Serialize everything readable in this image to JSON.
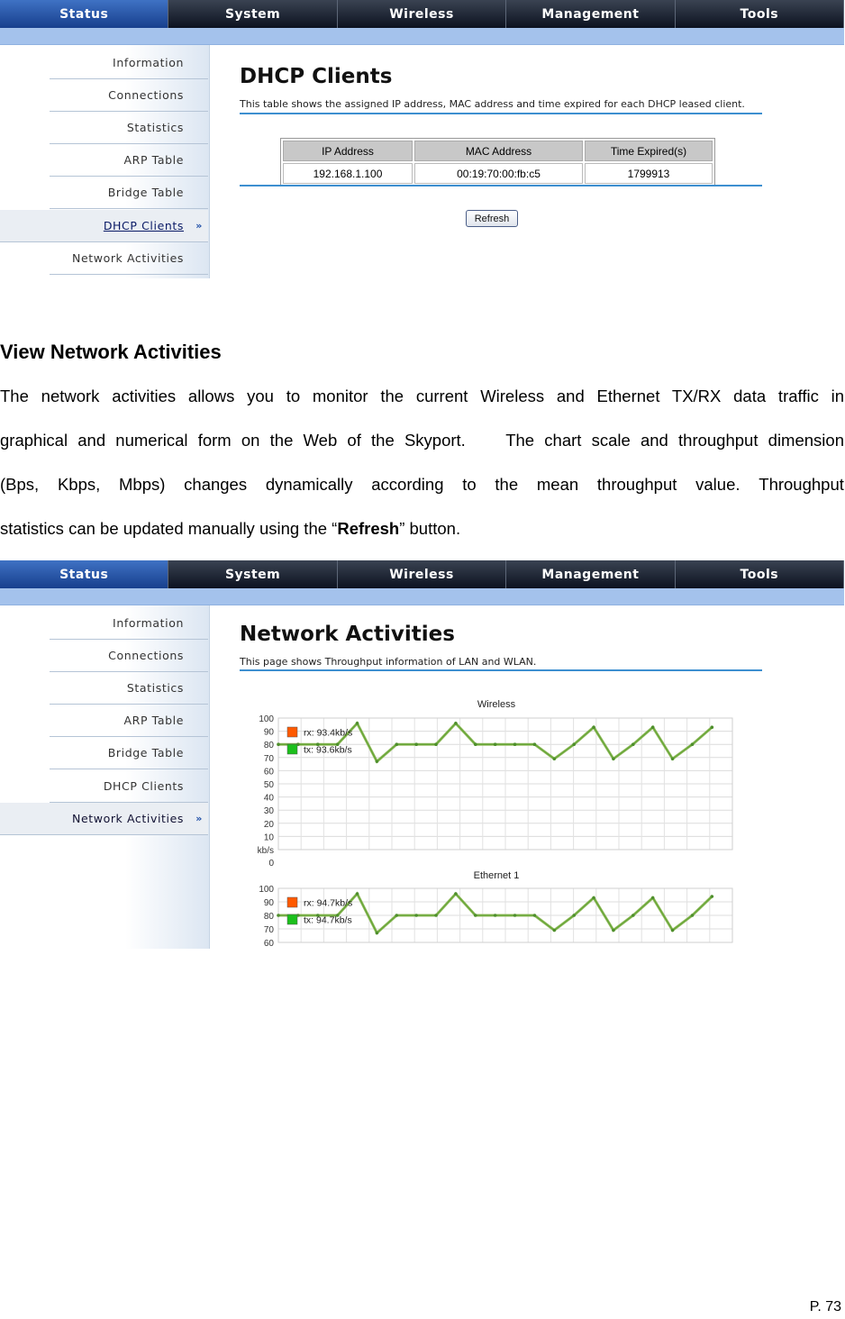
{
  "screenshot1": {
    "nav_tabs": [
      "Status",
      "System",
      "Wireless",
      "Management",
      "Tools"
    ],
    "sidebar": [
      "Information",
      "Connections",
      "Statistics",
      "ARP Table",
      "Bridge Table",
      "DHCP Clients",
      "Network Activities"
    ],
    "active_item": "DHCP Clients",
    "title": "DHCP Clients",
    "description": "This table shows the assigned IP address, MAC address and time expired for each DHCP leased client.",
    "table": {
      "headers": [
        "IP Address",
        "MAC Address",
        "Time Expired(s)"
      ],
      "rows": [
        [
          "192.168.1.100",
          "00:19:70:00:fb:c5",
          "1799913"
        ]
      ]
    },
    "refresh_label": "Refresh"
  },
  "section_heading": "View Network Activities",
  "paragraph": {
    "line1": "The network activities allows you to monitor the current Wireless and Ethernet TX/RX data traffic in",
    "line2": "graphical and numerical form on the Web of the Skyport.    The chart scale and throughput dimension",
    "line3_words": [
      "(Bps,",
      "Kbps,",
      "Mbps)",
      "changes",
      "dynamically",
      "according",
      "to",
      "the",
      "mean",
      "throughput",
      "value.",
      "Throughput"
    ],
    "line4_before": "statistics can be updated manually using the “",
    "line4_bold": "Refresh",
    "line4_after": "” button."
  },
  "screenshot2": {
    "nav_tabs": [
      "Status",
      "System",
      "Wireless",
      "Management",
      "Tools"
    ],
    "sidebar": [
      "Information",
      "Connections",
      "Statistics",
      "ARP Table",
      "Bridge Table",
      "DHCP Clients",
      "Network Activities"
    ],
    "active_item": "Network Activities",
    "title": "Network Activities",
    "description": "This page shows Throughput information of LAN and WLAN.",
    "arrow_glyph": "»"
  },
  "chart_data": [
    {
      "type": "line",
      "title": "Wireless",
      "ylabel": "kb/s",
      "ylim": [
        0,
        100
      ],
      "yticks": [
        100,
        90,
        80,
        70,
        60,
        50,
        40,
        30,
        20,
        10,
        0
      ],
      "grid": true,
      "legend_placement": "top-left",
      "series": [
        {
          "name": "rx: 93.4kb/s",
          "color": "#ff5a00",
          "values": [
            80,
            80,
            80,
            80,
            96,
            67,
            80,
            80,
            80,
            96,
            80,
            80,
            80,
            80,
            69,
            80,
            93,
            69,
            80,
            93,
            69,
            80,
            93
          ]
        },
        {
          "name": "tx: 93.6kb/s",
          "color": "#1cc01c",
          "values": [
            80,
            80,
            80,
            80,
            96,
            67,
            80,
            80,
            80,
            96,
            80,
            80,
            80,
            80,
            69,
            80,
            93,
            69,
            80,
            93,
            69,
            80,
            93
          ]
        }
      ]
    },
    {
      "type": "line",
      "title": "Ethernet 1",
      "ylim": [
        60,
        100
      ],
      "yticks": [
        100,
        90,
        80,
        70,
        60
      ],
      "grid": true,
      "legend_placement": "top-left",
      "series": [
        {
          "name": "rx: 94.7kb/s",
          "color": "#ff5a00",
          "values": [
            80,
            80,
            80,
            80,
            96,
            67,
            80,
            80,
            80,
            96,
            80,
            80,
            80,
            80,
            69,
            80,
            93,
            69,
            80,
            93,
            69,
            80,
            94
          ]
        },
        {
          "name": "tx: 94.7kb/s",
          "color": "#1cc01c",
          "values": [
            80,
            80,
            80,
            80,
            96,
            67,
            80,
            80,
            80,
            96,
            80,
            80,
            80,
            80,
            69,
            80,
            93,
            69,
            80,
            93,
            69,
            80,
            94
          ]
        }
      ]
    }
  ],
  "page_number": "P. 73"
}
